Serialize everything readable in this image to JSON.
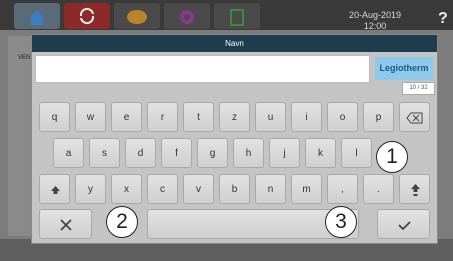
{
  "topbar": {
    "date": "20-Aug-2019",
    "time": "12:00",
    "help_label": "?",
    "tabs": [
      {
        "name": "home-icon",
        "color": "#3a7fbf"
      },
      {
        "name": "sync-icon",
        "color": "#cc2222"
      },
      {
        "name": "drop-icon",
        "color": "#d8a12a"
      },
      {
        "name": "gear-icon",
        "color": "#a33aa3"
      },
      {
        "name": "document-icon",
        "color": "#3d8a3d"
      }
    ]
  },
  "background": {
    "label": "VEN"
  },
  "dialog": {
    "title": "Navn",
    "input_value": "",
    "selected_value": "Legiotherm",
    "counter": "10 / 32"
  },
  "keyboard": {
    "row1": [
      "q",
      "w",
      "e",
      "r",
      "t",
      "z",
      "u",
      "i",
      "o",
      "p"
    ],
    "row2": [
      "a",
      "s",
      "d",
      "f",
      "g",
      "h",
      "j",
      "k",
      "l"
    ],
    "row3": [
      "y",
      "x",
      "c",
      "v",
      "b",
      "n",
      "m",
      ",",
      "."
    ],
    "icons": {
      "backspace": "backspace-icon",
      "shift_left": "shift-icon",
      "shift_right": "shift-icon",
      "cancel": "close-icon",
      "confirm": "check-icon"
    }
  },
  "callouts": [
    "1",
    "2",
    "3"
  ]
}
